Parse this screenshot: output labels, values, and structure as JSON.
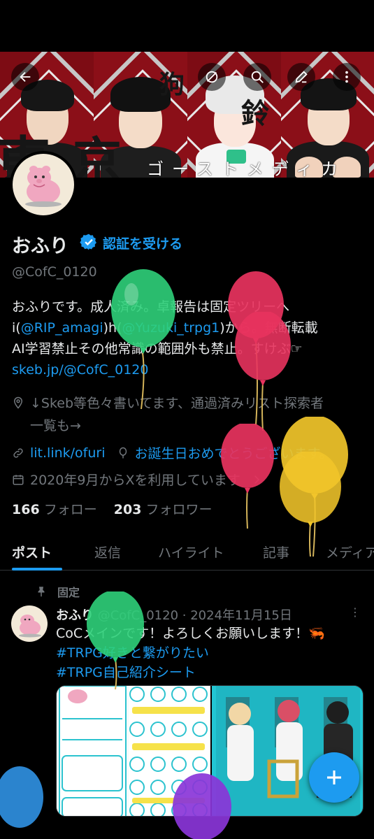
{
  "header": {
    "back_icon": "arrow-left-icon",
    "actions": [
      "mute-icon",
      "search-icon",
      "edit-icon",
      "more-vertical-icon"
    ]
  },
  "banner": {
    "kanji_1": "東",
    "kanji_2": "京",
    "kanji_3": "狗",
    "kanji_4": "鈴",
    "subtitle": "ゴーストメディカ"
  },
  "profile": {
    "name": "おふり",
    "verify_label": "認証を受ける",
    "handle": "@CofC_0120",
    "bio": {
      "line1": "おふりです。成人済み。卓報告は固定ツリーへ",
      "line2_prefix": "i(",
      "mention1": "@RIP_amagi",
      "line2_mid": ")h(",
      "mention2": "@Yuzuki_trpg1",
      "line2_suffix": ")から。無断転載",
      "line3": "AI学習禁止その他常識の範囲外も禁止。すけぶ☞",
      "skeb_link": "skeb.jp/@CofC_0120"
    },
    "location_line1": "↓Skeb等色々書いてます、通過済みリスト探索者",
    "location_line2": "一覧も→",
    "website": "lit.link/ofuri",
    "birthday": "お誕生日おめでとうございます。",
    "joined": "2020年9月からXを利用しています",
    "following_count": "166",
    "following_label": "フォロー",
    "followers_count": "203",
    "followers_label": "フォロワー"
  },
  "tabs": [
    "ポスト",
    "返信",
    "ハイライト",
    "記事",
    "メディア"
  ],
  "pinned_post": {
    "pinned_label": "固定",
    "author": "おふり",
    "handle": "@CofC_0120",
    "date": "2024年11月15日",
    "text": "CoCメインです！よろしくお願いします！🦐",
    "hashtag1": "#TRPG好きと繋がりたい",
    "hashtag2": "#TRPG自己紹介シート"
  },
  "colors": {
    "accent": "#1d9bf0",
    "background": "#000000",
    "muted": "#71767b"
  }
}
